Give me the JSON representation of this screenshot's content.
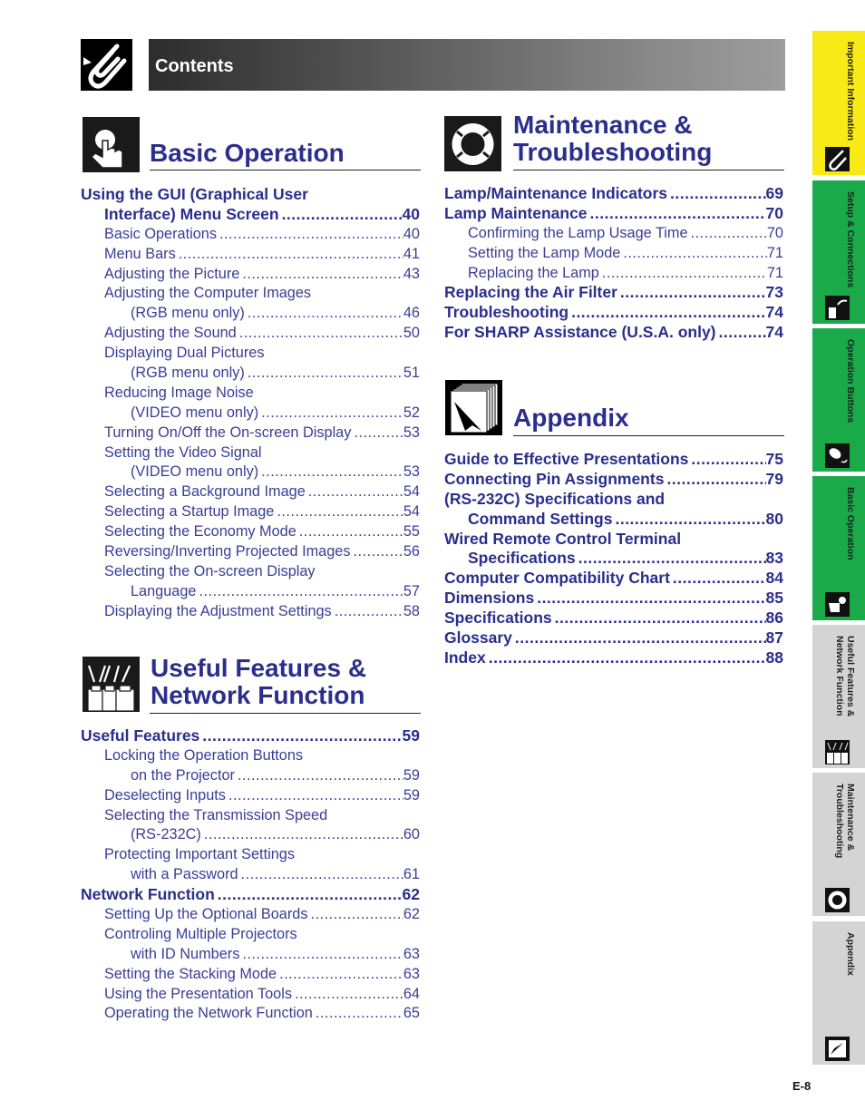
{
  "header": {
    "title": "Contents",
    "icon": "paperclip-icon"
  },
  "colors": {
    "heading_blue": "#2b2e8c",
    "tab_yellow": "#f7ea16",
    "tab_green": "#1aaa4a",
    "tab_gray": "#d4d4d4"
  },
  "sections": {
    "basic": {
      "title": "Basic Operation",
      "icon": "hand-pointer-icon",
      "entries": [
        {
          "text": "Using the GUI (Graphical User",
          "page": "",
          "level": "main"
        },
        {
          "text": "Interface) Menu Screen",
          "page": "40",
          "level": "main2"
        },
        {
          "text": "Basic Operations",
          "page": "40",
          "level": "sub"
        },
        {
          "text": "Menu Bars",
          "page": "41",
          "level": "sub"
        },
        {
          "text": "Adjusting the Picture",
          "page": "43",
          "level": "sub"
        },
        {
          "text": "Adjusting the Computer Images",
          "page": "",
          "level": "sub"
        },
        {
          "text": "(RGB menu only)",
          "page": "46",
          "level": "sub2"
        },
        {
          "text": "Adjusting the Sound",
          "page": "50",
          "level": "sub"
        },
        {
          "text": "Displaying Dual Pictures",
          "page": "",
          "level": "sub"
        },
        {
          "text": "(RGB menu only)",
          "page": "51",
          "level": "sub2"
        },
        {
          "text": "Reducing Image Noise",
          "page": "",
          "level": "sub"
        },
        {
          "text": "(VIDEO menu only)",
          "page": "52",
          "level": "sub2"
        },
        {
          "text": "Turning On/Off the On-screen Display",
          "page": "53",
          "level": "sub"
        },
        {
          "text": "Setting the Video Signal",
          "page": "",
          "level": "sub"
        },
        {
          "text": "(VIDEO menu only)",
          "page": "53",
          "level": "sub2"
        },
        {
          "text": "Selecting a Background Image",
          "page": "54",
          "level": "sub"
        },
        {
          "text": "Selecting a Startup Image",
          "page": "54",
          "level": "sub"
        },
        {
          "text": "Selecting the Economy Mode",
          "page": "55",
          "level": "sub"
        },
        {
          "text": "Reversing/Inverting Projected Images",
          "page": "56",
          "level": "sub"
        },
        {
          "text": "Selecting the On-screen Display",
          "page": "",
          "level": "sub"
        },
        {
          "text": "Language",
          "page": "57",
          "level": "sub2"
        },
        {
          "text": "Displaying the Adjustment Settings",
          "page": "58",
          "level": "sub"
        }
      ]
    },
    "useful": {
      "title_line1": "Useful Features &",
      "title_line2": "Network Function",
      "icon": "projectors-icon",
      "entries": [
        {
          "text": "Useful Features",
          "page": "59",
          "level": "main"
        },
        {
          "text": "Locking the Operation Buttons",
          "page": "",
          "level": "sub"
        },
        {
          "text": "on the Projector",
          "page": "59",
          "level": "sub2"
        },
        {
          "text": "Deselecting Inputs",
          "page": "59",
          "level": "sub"
        },
        {
          "text": "Selecting the Transmission Speed",
          "page": "",
          "level": "sub"
        },
        {
          "text": "(RS-232C)",
          "page": "60",
          "level": "sub2"
        },
        {
          "text": "Protecting Important Settings",
          "page": "",
          "level": "sub"
        },
        {
          "text": "with a Password",
          "page": "61",
          "level": "sub2"
        },
        {
          "text": "Network Function",
          "page": "62",
          "level": "main"
        },
        {
          "text": "Setting Up the Optional Boards",
          "page": "62",
          "level": "sub"
        },
        {
          "text": "Controling Multiple Projectors",
          "page": "",
          "level": "sub"
        },
        {
          "text": "with ID Numbers",
          "page": "63",
          "level": "sub2"
        },
        {
          "text": "Setting the Stacking Mode",
          "page": "63",
          "level": "sub"
        },
        {
          "text": "Using the Presentation Tools",
          "page": "64",
          "level": "sub"
        },
        {
          "text": "Operating the Network Function",
          "page": "65",
          "level": "sub"
        }
      ]
    },
    "maintenance": {
      "title_line1": "Maintenance &",
      "title_line2": "Troubleshooting",
      "icon": "lifebuoy-icon",
      "entries": [
        {
          "text": "Lamp/Maintenance Indicators",
          "page": "69",
          "level": "main"
        },
        {
          "text": "Lamp Maintenance",
          "page": "70",
          "level": "main"
        },
        {
          "text": "Confirming the Lamp Usage Time",
          "page": "70",
          "level": "sub"
        },
        {
          "text": "Setting the Lamp Mode",
          "page": "71",
          "level": "sub"
        },
        {
          "text": "Replacing the Lamp",
          "page": "71",
          "level": "sub"
        },
        {
          "text": "Replacing the Air Filter",
          "page": "73",
          "level": "main"
        },
        {
          "text": "Troubleshooting",
          "page": "74",
          "level": "main"
        },
        {
          "text": "For SHARP Assistance (U.S.A. only)",
          "page": "74",
          "level": "main"
        }
      ]
    },
    "appendix": {
      "title": "Appendix",
      "icon": "pages-arrow-icon",
      "entries": [
        {
          "text": "Guide to Effective Presentations",
          "page": "75",
          "level": "main"
        },
        {
          "text": "Connecting Pin Assignments",
          "page": "79",
          "level": "main"
        },
        {
          "text": "(RS-232C) Specifications and",
          "page": "",
          "level": "main"
        },
        {
          "text": "Command Settings",
          "page": "80",
          "level": "main2"
        },
        {
          "text": "Wired Remote Control Terminal",
          "page": "",
          "level": "main"
        },
        {
          "text": "Specifications",
          "page": "83",
          "level": "main2"
        },
        {
          "text": "Computer Compatibility Chart",
          "page": "84",
          "level": "main"
        },
        {
          "text": "Dimensions",
          "page": "85",
          "level": "main"
        },
        {
          "text": "Specifications",
          "page": "86",
          "level": "main"
        },
        {
          "text": "Glossary",
          "page": "87",
          "level": "main"
        },
        {
          "text": "Index",
          "page": "88",
          "level": "main"
        }
      ]
    }
  },
  "side_tabs": [
    {
      "label": "Important Information",
      "icon": "paperclip-icon",
      "color": "yellow"
    },
    {
      "label": "Setup & Connections",
      "icon": "connector-icon",
      "color": "green"
    },
    {
      "label": "Operation Buttons",
      "icon": "remote-control-icon",
      "color": "green"
    },
    {
      "label": "Basic Operation",
      "icon": "hand-pointer-icon",
      "color": "green"
    },
    {
      "label": "Useful Features & Network Function",
      "icon": "projectors-icon",
      "color": "gray"
    },
    {
      "label": "Maintenance & Troubleshooting",
      "icon": "lifebuoy-icon",
      "color": "gray"
    },
    {
      "label": "Appendix",
      "icon": "pages-arrow-icon",
      "color": "gray"
    }
  ],
  "page_number": "E-8"
}
